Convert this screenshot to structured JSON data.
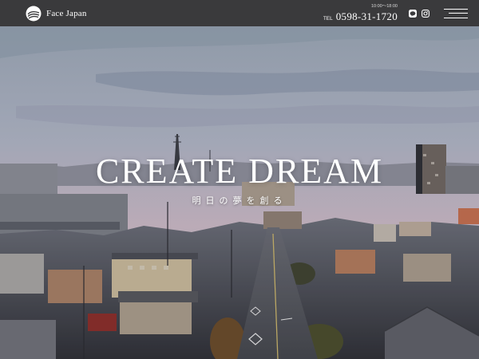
{
  "header": {
    "brand_name": "Face Japan",
    "hours": "10:00〜18:00",
    "tel_label": "TEL",
    "phone": "0598-31-1720",
    "icons": [
      "logo-icon",
      "line-icon",
      "instagram-icon",
      "hamburger-menu-icon"
    ]
  },
  "hero": {
    "headline": "CREATE DREAM",
    "subline": "明日の夢を創る"
  },
  "colors": {
    "header_bg": "#3a3a3c",
    "text": "#ffffff"
  }
}
